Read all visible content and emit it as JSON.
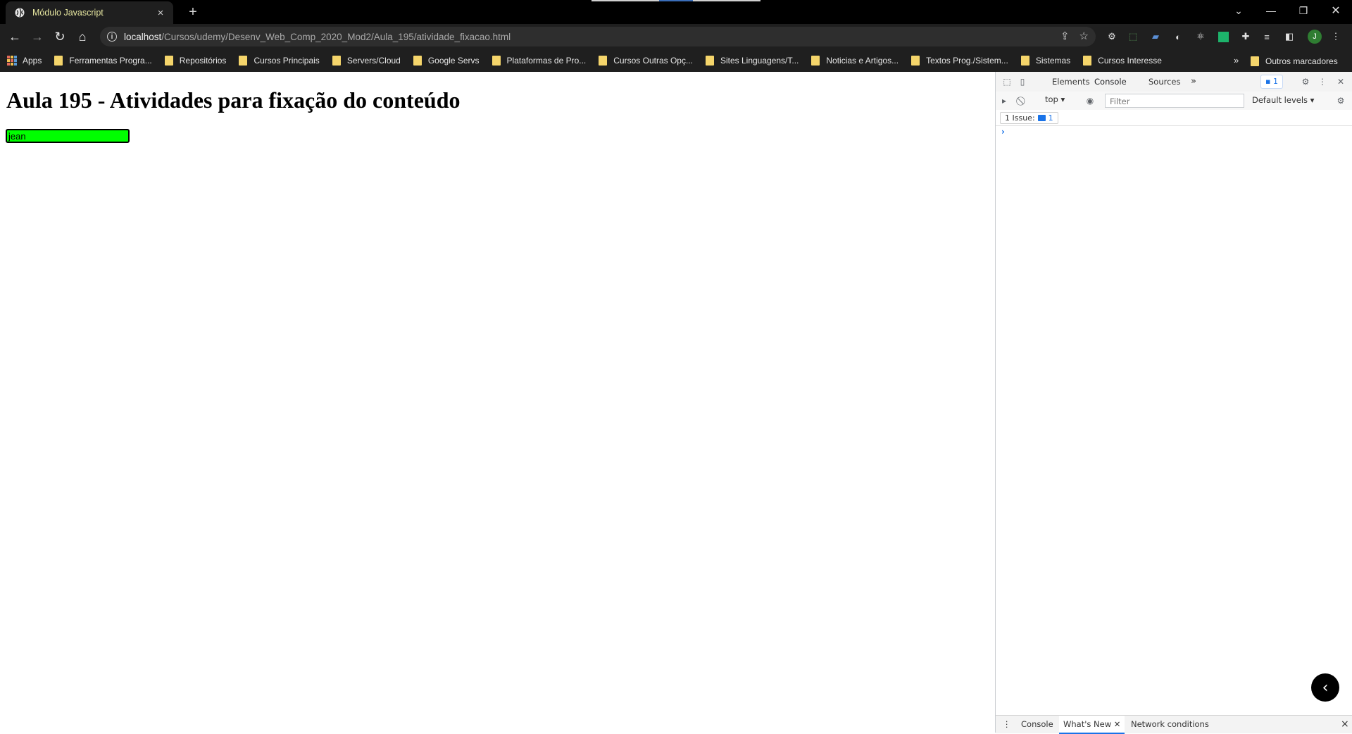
{
  "browser": {
    "tab_title": "Módulo Javascript",
    "tab_close": "×",
    "new_tab": "+",
    "url_host": "localhost",
    "url_path": "/Cursos/udemy/Desenv_Web_Comp_2020_Mod2/Aula_195/atividade_fixacao.html",
    "profile_initial": "J",
    "bookmarks": [
      "Apps",
      "Ferramentas Progra...",
      "Repositórios",
      "Cursos Principais",
      "Servers/Cloud",
      "Google Servs",
      "Plataformas de Pro...",
      "Cursos Outras Opç...",
      "Sites Linguagens/T...",
      "Noticias e Artigos...",
      "Textos Prog./Sistem...",
      "Sistemas",
      "Cursos Interesse"
    ],
    "bookmarks_more": "»",
    "other_bookmarks": "Outros marcadores"
  },
  "page": {
    "heading": "Aula 195 - Atividades para fixação do conteúdo",
    "input_value": "jean"
  },
  "devtools": {
    "tabs": [
      "Elements",
      "Console",
      "Sources"
    ],
    "more_tabs": "»",
    "message_count": "1",
    "context": "top",
    "filter_placeholder": "Filter",
    "levels": "Default levels",
    "issues_label": "1 Issue:",
    "issues_count": "1",
    "prompt": "›",
    "drawer_tabs": [
      "Console",
      "What's New",
      "Network conditions"
    ],
    "drawer_close": "×"
  }
}
